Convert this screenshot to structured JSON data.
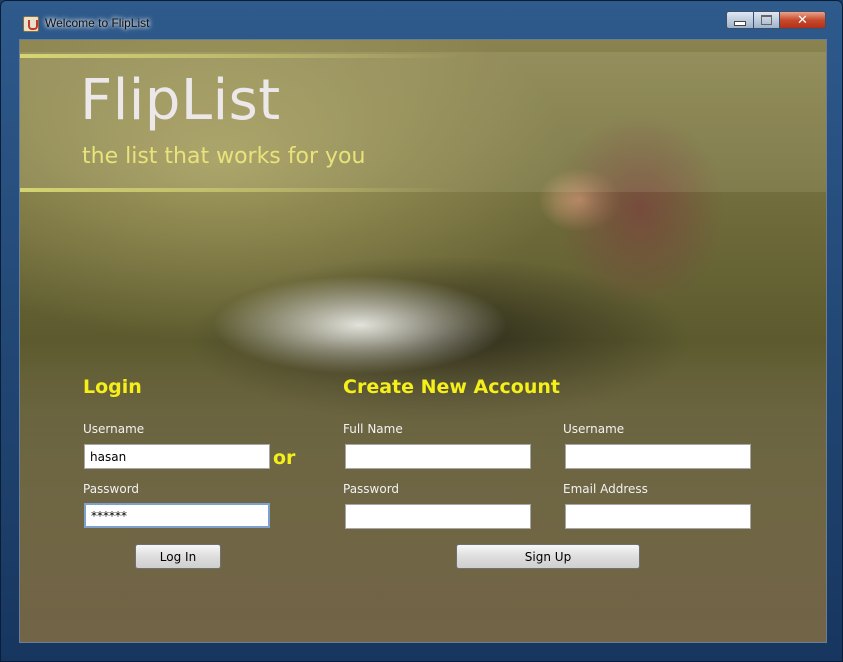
{
  "window": {
    "title": "Welcome to FlipList",
    "caption": {
      "minimize": "–",
      "maximize": "□",
      "close": "✕"
    }
  },
  "banner": {
    "logo": "FlipList",
    "tagline": "the list that works for you"
  },
  "login": {
    "heading": "Login",
    "username_label": "Username",
    "username_value": "hasan",
    "password_label": "Password",
    "password_value": "******",
    "button_label": "Log In"
  },
  "separator": "or",
  "signup": {
    "heading": "Create New Account",
    "fullname_label": "Full Name",
    "fullname_value": "",
    "username_label": "Username",
    "username_value": "",
    "password_label": "Password",
    "password_value": "",
    "email_label": "Email Address",
    "email_value": "",
    "button_label": "Sign Up"
  },
  "colors": {
    "accent_yellow": "#f5ef1a",
    "tagline_yellow": "#e9e37c",
    "titlebar_blue": "#2e5a8c"
  }
}
